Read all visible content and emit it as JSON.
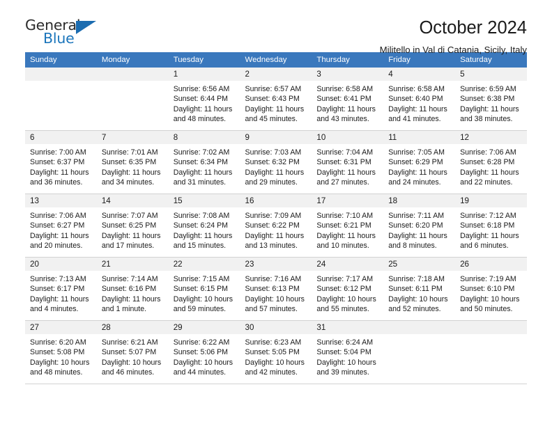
{
  "brand": {
    "name_part1": "General",
    "name_part2": "Blue"
  },
  "header": {
    "title": "October 2024",
    "subtitle": "Militello in Val di Catania, Sicily, Italy"
  },
  "colors": {
    "header_blue": "#3a78bd",
    "brand_blue": "#1b75bb",
    "daynum_bg": "#f1f1f1",
    "grid_line": "#d2d2d2"
  },
  "calendar": {
    "weekday_headers": [
      "Sunday",
      "Monday",
      "Tuesday",
      "Wednesday",
      "Thursday",
      "Friday",
      "Saturday"
    ],
    "labels": {
      "sunrise": "Sunrise:",
      "sunset": "Sunset:",
      "daylight": "Daylight:"
    },
    "weeks": [
      [
        {
          "day": "",
          "blank": true
        },
        {
          "day": "",
          "blank": true
        },
        {
          "day": "1",
          "sunrise": "Sunrise: 6:56 AM",
          "sunset": "Sunset: 6:44 PM",
          "daylight": "Daylight: 11 hours and 48 minutes."
        },
        {
          "day": "2",
          "sunrise": "Sunrise: 6:57 AM",
          "sunset": "Sunset: 6:43 PM",
          "daylight": "Daylight: 11 hours and 45 minutes."
        },
        {
          "day": "3",
          "sunrise": "Sunrise: 6:58 AM",
          "sunset": "Sunset: 6:41 PM",
          "daylight": "Daylight: 11 hours and 43 minutes."
        },
        {
          "day": "4",
          "sunrise": "Sunrise: 6:58 AM",
          "sunset": "Sunset: 6:40 PM",
          "daylight": "Daylight: 11 hours and 41 minutes."
        },
        {
          "day": "5",
          "sunrise": "Sunrise: 6:59 AM",
          "sunset": "Sunset: 6:38 PM",
          "daylight": "Daylight: 11 hours and 38 minutes."
        }
      ],
      [
        {
          "day": "6",
          "sunrise": "Sunrise: 7:00 AM",
          "sunset": "Sunset: 6:37 PM",
          "daylight": "Daylight: 11 hours and 36 minutes."
        },
        {
          "day": "7",
          "sunrise": "Sunrise: 7:01 AM",
          "sunset": "Sunset: 6:35 PM",
          "daylight": "Daylight: 11 hours and 34 minutes."
        },
        {
          "day": "8",
          "sunrise": "Sunrise: 7:02 AM",
          "sunset": "Sunset: 6:34 PM",
          "daylight": "Daylight: 11 hours and 31 minutes."
        },
        {
          "day": "9",
          "sunrise": "Sunrise: 7:03 AM",
          "sunset": "Sunset: 6:32 PM",
          "daylight": "Daylight: 11 hours and 29 minutes."
        },
        {
          "day": "10",
          "sunrise": "Sunrise: 7:04 AM",
          "sunset": "Sunset: 6:31 PM",
          "daylight": "Daylight: 11 hours and 27 minutes."
        },
        {
          "day": "11",
          "sunrise": "Sunrise: 7:05 AM",
          "sunset": "Sunset: 6:29 PM",
          "daylight": "Daylight: 11 hours and 24 minutes."
        },
        {
          "day": "12",
          "sunrise": "Sunrise: 7:06 AM",
          "sunset": "Sunset: 6:28 PM",
          "daylight": "Daylight: 11 hours and 22 minutes."
        }
      ],
      [
        {
          "day": "13",
          "sunrise": "Sunrise: 7:06 AM",
          "sunset": "Sunset: 6:27 PM",
          "daylight": "Daylight: 11 hours and 20 minutes."
        },
        {
          "day": "14",
          "sunrise": "Sunrise: 7:07 AM",
          "sunset": "Sunset: 6:25 PM",
          "daylight": "Daylight: 11 hours and 17 minutes."
        },
        {
          "day": "15",
          "sunrise": "Sunrise: 7:08 AM",
          "sunset": "Sunset: 6:24 PM",
          "daylight": "Daylight: 11 hours and 15 minutes."
        },
        {
          "day": "16",
          "sunrise": "Sunrise: 7:09 AM",
          "sunset": "Sunset: 6:22 PM",
          "daylight": "Daylight: 11 hours and 13 minutes."
        },
        {
          "day": "17",
          "sunrise": "Sunrise: 7:10 AM",
          "sunset": "Sunset: 6:21 PM",
          "daylight": "Daylight: 11 hours and 10 minutes."
        },
        {
          "day": "18",
          "sunrise": "Sunrise: 7:11 AM",
          "sunset": "Sunset: 6:20 PM",
          "daylight": "Daylight: 11 hours and 8 minutes."
        },
        {
          "day": "19",
          "sunrise": "Sunrise: 7:12 AM",
          "sunset": "Sunset: 6:18 PM",
          "daylight": "Daylight: 11 hours and 6 minutes."
        }
      ],
      [
        {
          "day": "20",
          "sunrise": "Sunrise: 7:13 AM",
          "sunset": "Sunset: 6:17 PM",
          "daylight": "Daylight: 11 hours and 4 minutes."
        },
        {
          "day": "21",
          "sunrise": "Sunrise: 7:14 AM",
          "sunset": "Sunset: 6:16 PM",
          "daylight": "Daylight: 11 hours and 1 minute."
        },
        {
          "day": "22",
          "sunrise": "Sunrise: 7:15 AM",
          "sunset": "Sunset: 6:15 PM",
          "daylight": "Daylight: 10 hours and 59 minutes."
        },
        {
          "day": "23",
          "sunrise": "Sunrise: 7:16 AM",
          "sunset": "Sunset: 6:13 PM",
          "daylight": "Daylight: 10 hours and 57 minutes."
        },
        {
          "day": "24",
          "sunrise": "Sunrise: 7:17 AM",
          "sunset": "Sunset: 6:12 PM",
          "daylight": "Daylight: 10 hours and 55 minutes."
        },
        {
          "day": "25",
          "sunrise": "Sunrise: 7:18 AM",
          "sunset": "Sunset: 6:11 PM",
          "daylight": "Daylight: 10 hours and 52 minutes."
        },
        {
          "day": "26",
          "sunrise": "Sunrise: 7:19 AM",
          "sunset": "Sunset: 6:10 PM",
          "daylight": "Daylight: 10 hours and 50 minutes."
        }
      ],
      [
        {
          "day": "27",
          "sunrise": "Sunrise: 6:20 AM",
          "sunset": "Sunset: 5:08 PM",
          "daylight": "Daylight: 10 hours and 48 minutes."
        },
        {
          "day": "28",
          "sunrise": "Sunrise: 6:21 AM",
          "sunset": "Sunset: 5:07 PM",
          "daylight": "Daylight: 10 hours and 46 minutes."
        },
        {
          "day": "29",
          "sunrise": "Sunrise: 6:22 AM",
          "sunset": "Sunset: 5:06 PM",
          "daylight": "Daylight: 10 hours and 44 minutes."
        },
        {
          "day": "30",
          "sunrise": "Sunrise: 6:23 AM",
          "sunset": "Sunset: 5:05 PM",
          "daylight": "Daylight: 10 hours and 42 minutes."
        },
        {
          "day": "31",
          "sunrise": "Sunrise: 6:24 AM",
          "sunset": "Sunset: 5:04 PM",
          "daylight": "Daylight: 10 hours and 39 minutes."
        },
        {
          "day": "",
          "blank": true
        },
        {
          "day": "",
          "blank": true
        }
      ]
    ]
  }
}
